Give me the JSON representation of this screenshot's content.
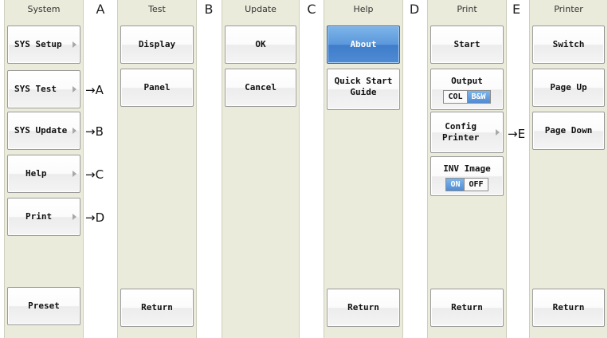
{
  "columns": {
    "system": {
      "title": "System",
      "buttons": [
        "SYS Setup",
        "SYS Test",
        "SYS Update",
        "Help",
        "Print",
        "Preset"
      ]
    },
    "test": {
      "title": "Test",
      "buttons": [
        "Display",
        "Panel",
        "Return"
      ]
    },
    "update": {
      "title": "Update",
      "buttons": [
        "OK",
        "Cancel"
      ]
    },
    "help": {
      "title": "Help",
      "buttons": [
        "About",
        "Quick Start\nGuide",
        "Return"
      ]
    },
    "print": {
      "title": "Print",
      "start": "Start",
      "output": {
        "label": "Output",
        "options": [
          "COL",
          "B&W"
        ],
        "selected": "B&W"
      },
      "config": "Config\nPrinter",
      "inv_image": {
        "label": "INV Image",
        "options": [
          "ON",
          "OFF"
        ],
        "selected": "ON"
      },
      "return": "Return"
    },
    "printer": {
      "title": "Printer",
      "buttons": [
        "Switch",
        "Page Up",
        "Page Down",
        "Return"
      ]
    }
  },
  "letters": [
    "A",
    "B",
    "C",
    "D",
    "E"
  ],
  "arrows": [
    "→A",
    "→B",
    "→C",
    "→D",
    "→E"
  ],
  "colors": {
    "panel": "#ebebdc",
    "active": "#4f8bd4"
  }
}
